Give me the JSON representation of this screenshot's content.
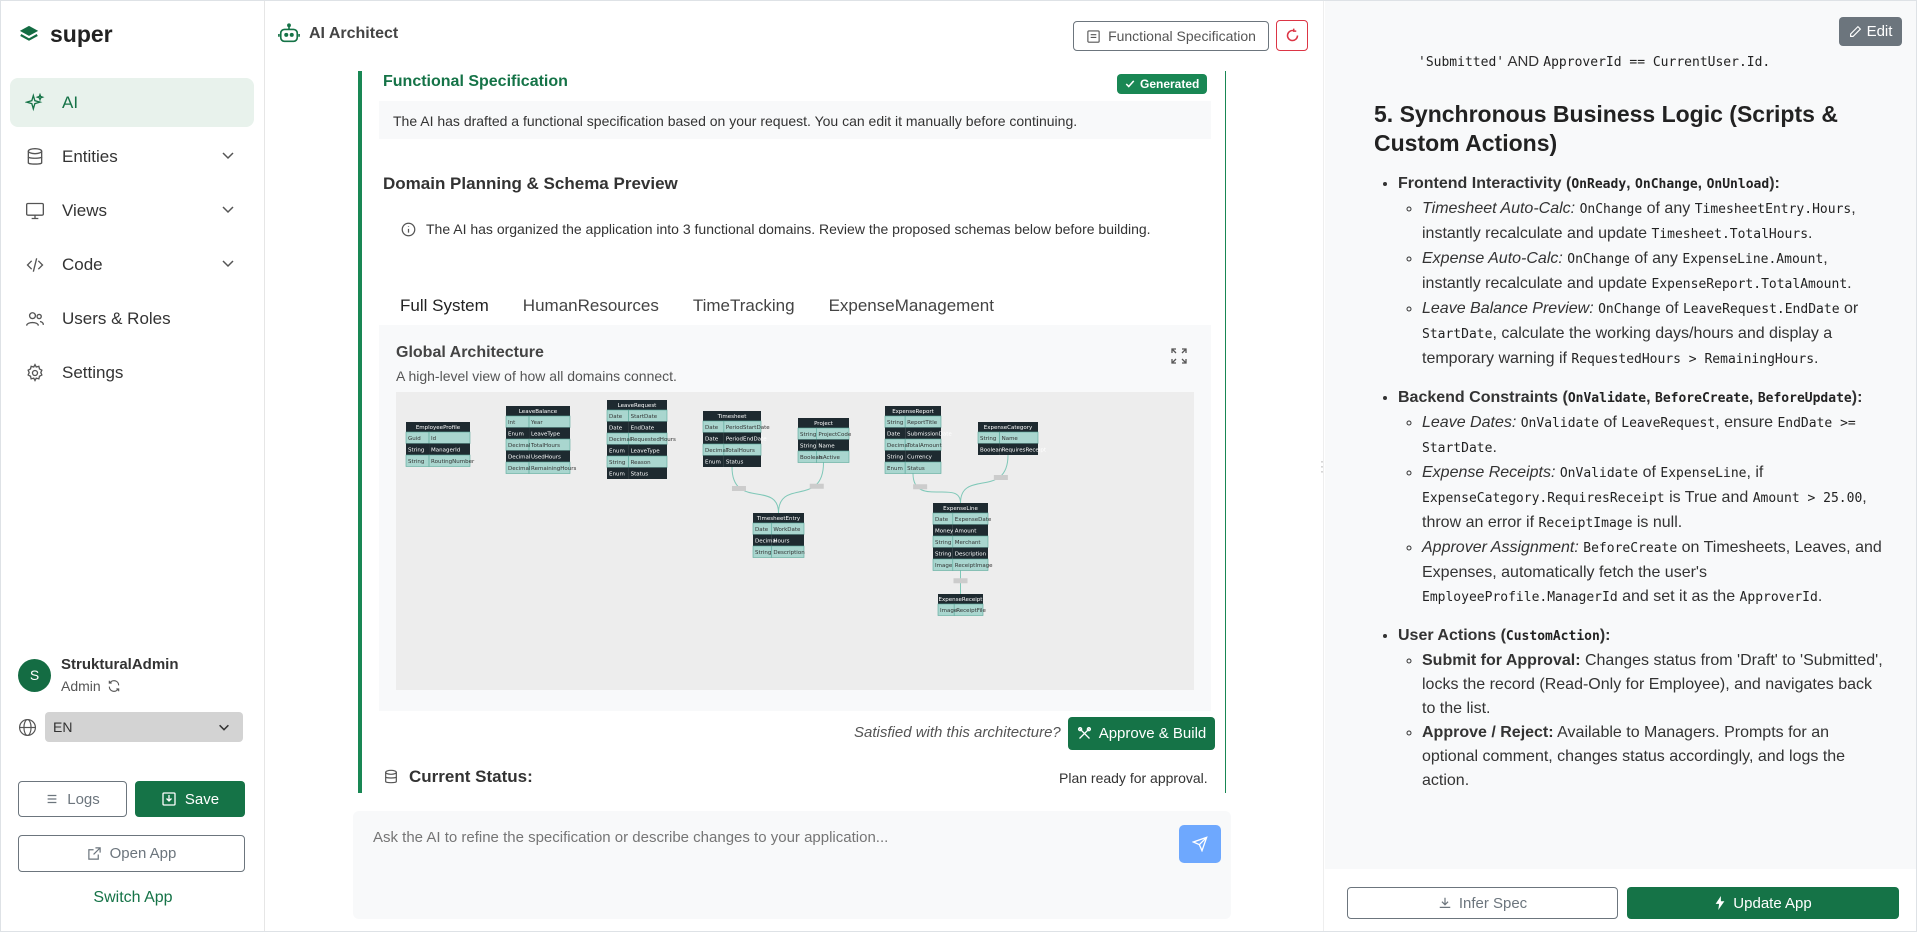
{
  "app": {
    "brand": "super",
    "title": "AI Architect"
  },
  "sidebar": {
    "items": [
      {
        "label": "AI",
        "icon": "sparkles-icon",
        "active": true
      },
      {
        "label": "Entities",
        "icon": "database-icon"
      },
      {
        "label": "Views",
        "icon": "monitor-icon"
      },
      {
        "label": "Code",
        "icon": "code-icon"
      },
      {
        "label": "Users & Roles",
        "icon": "users-icon"
      },
      {
        "label": "Settings",
        "icon": "gear-icon"
      }
    ],
    "user": {
      "initial": "S",
      "name": "StrukturalAdmin",
      "role": "Admin"
    },
    "language": "EN",
    "logs_label": "Logs",
    "save_label": "Save",
    "open_app_label": "Open App",
    "switch_app_label": "Switch App"
  },
  "topbar": {
    "spec_button": "Functional Specification"
  },
  "main": {
    "fs_title": "Functional Specification",
    "generated_badge": "Generated",
    "fs_desc": "The AI has drafted a functional specification based on your request. You can edit it manually before continuing.",
    "dp_title": "Domain Planning & Schema Preview",
    "info": "The AI has organized the application into 3 functional domains. Review the proposed schemas below before building.",
    "tabs": [
      "Full System",
      "HumanResources",
      "TimeTracking",
      "ExpenseManagement"
    ],
    "arch_title": "Global Architecture",
    "arch_sub": "A high-level view of how all domains connect.",
    "satisfied": "Satisfied with this architecture?",
    "approve_label": "Approve & Build",
    "status_label": "Current Status:",
    "status_value": "Plan ready for approval."
  },
  "diagram": {
    "entities": [
      {
        "name": "EmployeeProfile",
        "rows": [
          [
            "Guid",
            "Id"
          ],
          [
            "String",
            "ManagerId"
          ],
          [
            "String",
            "RoutingNumber"
          ]
        ]
      },
      {
        "name": "LeaveBalance",
        "rows": [
          [
            "Int",
            "Year"
          ],
          [
            "Enum",
            "LeaveType"
          ],
          [
            "Decimal",
            "TotalHours"
          ],
          [
            "Decimal",
            "UsedHours"
          ],
          [
            "Decimal",
            "RemainingHours"
          ]
        ]
      },
      {
        "name": "LeaveRequest",
        "rows": [
          [
            "Date",
            "StartDate"
          ],
          [
            "Date",
            "EndDate"
          ],
          [
            "Decimal",
            "RequestedHours"
          ],
          [
            "Enum",
            "LeaveType"
          ],
          [
            "String",
            "Reason"
          ],
          [
            "Enum",
            "Status"
          ]
        ]
      },
      {
        "name": "Timesheet",
        "rows": [
          [
            "Date",
            "PeriodStartDate"
          ],
          [
            "Date",
            "PeriodEndDate"
          ],
          [
            "Decimal",
            "TotalHours"
          ],
          [
            "Enum",
            "Status"
          ]
        ]
      },
      {
        "name": "Project",
        "rows": [
          [
            "String",
            "ProjectCode"
          ],
          [
            "String",
            "Name"
          ],
          [
            "Boolean",
            "IsActive"
          ]
        ]
      },
      {
        "name": "ExpenseReport",
        "rows": [
          [
            "String",
            "ReportTitle"
          ],
          [
            "Date",
            "SubmissionDate"
          ],
          [
            "Decimal",
            "TotalAmount"
          ],
          [
            "String",
            "Currency"
          ],
          [
            "Enum",
            "Status"
          ]
        ]
      },
      {
        "name": "ExpenseCategory",
        "rows": [
          [
            "String",
            "Name"
          ],
          [
            "Boolean",
            "RequiresReceipt"
          ]
        ]
      },
      {
        "name": "TimesheetEntry",
        "rows": [
          [
            "Date",
            "WorkDate"
          ],
          [
            "Decimal",
            "Hours"
          ],
          [
            "String",
            "Description"
          ]
        ]
      },
      {
        "name": "ExpenseLine",
        "rows": [
          [
            "Date",
            "ExpenseDate"
          ],
          [
            "Money",
            "Amount"
          ],
          [
            "String",
            "Merchant"
          ],
          [
            "String",
            "Description"
          ],
          [
            "Image",
            "ReceiptImage"
          ]
        ]
      },
      {
        "name": "ExpenseReceipt",
        "rows": [
          [
            "Image",
            "ReceiptFile"
          ]
        ]
      }
    ]
  },
  "composer": {
    "placeholder": "Ask the AI to refine the specification or describe changes to your application..."
  },
  "right": {
    "edit_label": "Edit",
    "infer_label": "Infer Spec",
    "update_label": "Update App",
    "top_line_a": "'Submitted'",
    "top_line_b": "AND",
    "top_line_c": "ApproverId == CurrentUser.Id.",
    "section_title": "5. Synchronous Business Logic (Scripts & Custom Actions)",
    "frontend": {
      "title": "Frontend Interactivity",
      "paren_a": "OnReady",
      "paren_b": "OnChange",
      "paren_c": "OnUnload",
      "i1_em": "Timesheet Auto-Calc:",
      "i1_c1": "OnChange",
      "i1_t1": "of any",
      "i1_c2": "TimesheetEntry.Hours",
      "i1_t2": ", instantly recalculate and update",
      "i1_c3": "Timesheet.TotalHours",
      "i1_t3": ".",
      "i2_em": "Expense Auto-Calc:",
      "i2_c1": "OnChange",
      "i2_t1": "of any",
      "i2_c2": "ExpenseLine.Amount",
      "i2_t2": ", instantly recalculate and update",
      "i2_c3": "ExpenseReport.TotalAmount",
      "i2_t3": ".",
      "i3_em": "Leave Balance Preview:",
      "i3_c1": "OnChange",
      "i3_t1": "of",
      "i3_c2": "LeaveRequest.EndDate",
      "i3_t2": "or",
      "i3_c3": "StartDate",
      "i3_t3": ", calculate the working days/hours and display a temporary warning if",
      "i3_c4": "RequestedHours > RemainingHours",
      "i3_t4": "."
    },
    "backend": {
      "title": "Backend Constraints",
      "paren_a": "OnValidate",
      "paren_b": "BeforeCreate",
      "paren_c": "BeforeUpdate",
      "i1_em": "Leave Dates:",
      "i1_c1": "OnValidate",
      "i1_t1": "of",
      "i1_c2": "LeaveRequest",
      "i1_t2": ", ensure",
      "i1_c3": "EndDate >= StartDate",
      "i1_t3": ".",
      "i2_em": "Expense Receipts:",
      "i2_c1": "OnValidate",
      "i2_t1": "of",
      "i2_c2": "ExpenseLine",
      "i2_t2": ", if",
      "i2_c3": "ExpenseCategory.RequiresReceipt",
      "i2_t3": "is True and",
      "i2_c4": "Amount > 25.00",
      "i2_t4": ", throw an error if",
      "i2_c5": "ReceiptImage",
      "i2_t5": "is null.",
      "i3_em": "Approver Assignment:",
      "i3_c1": "BeforeCreate",
      "i3_t1": "on Timesheets, Leaves, and Expenses, automatically fetch the user's",
      "i3_c2": "EmployeeProfile.ManagerId",
      "i3_t2": "and set it as the",
      "i3_c3": "ApproverId",
      "i3_t3": "."
    },
    "actions": {
      "title": "User Actions",
      "paren": "CustomAction",
      "i1_b": "Submit for Approval:",
      "i1_t": "Changes status from 'Draft' to 'Submitted', locks the record (Read-Only for Employee), and navigates back to the list.",
      "i2_b": "Approve / Reject:",
      "i2_t": "Available to Managers. Prompts for an optional comment, changes status accordingly, and logs the action."
    }
  },
  "colors": {
    "accent": "#157347",
    "accent_light": "#e8f2ec",
    "danger": "#dc3545",
    "send": "#6ea8fe"
  }
}
